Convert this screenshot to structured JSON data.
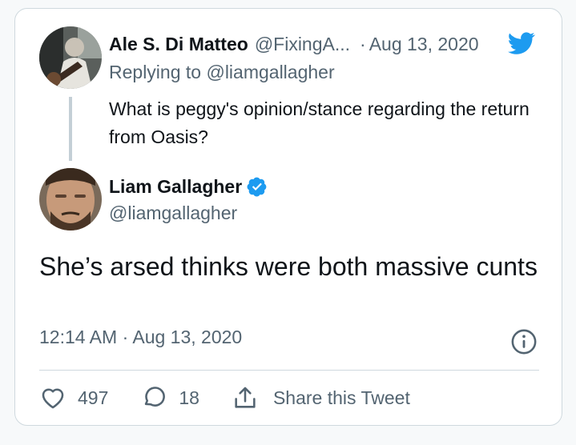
{
  "reply_tweet": {
    "author_name": "Ale S. Di Matteo",
    "author_handle": "@FixingA...",
    "separator": "·",
    "date": "Aug 13, 2020",
    "replying_prefix": "Replying to ",
    "replying_to": "@liamgallagher",
    "text": "What is peggy's opinion/stance regarding the return from Oasis?"
  },
  "main_tweet": {
    "author_name": "Liam Gallagher",
    "author_handle": "@liamgallagher",
    "text": "She’s arsed thinks were both massive cunts",
    "timestamp": "12:14 AM · Aug 13, 2020"
  },
  "actions": {
    "likes": "497",
    "replies": "18",
    "share_label": "Share this Tweet"
  },
  "colors": {
    "brand_blue": "#1d9bf0",
    "text_primary": "#0f1419",
    "text_secondary": "#536471",
    "border": "#cfd9de"
  },
  "icons": [
    "twitter-bird-icon",
    "verified-badge-icon",
    "info-icon",
    "heart-icon",
    "reply-bubble-icon",
    "share-icon"
  ]
}
